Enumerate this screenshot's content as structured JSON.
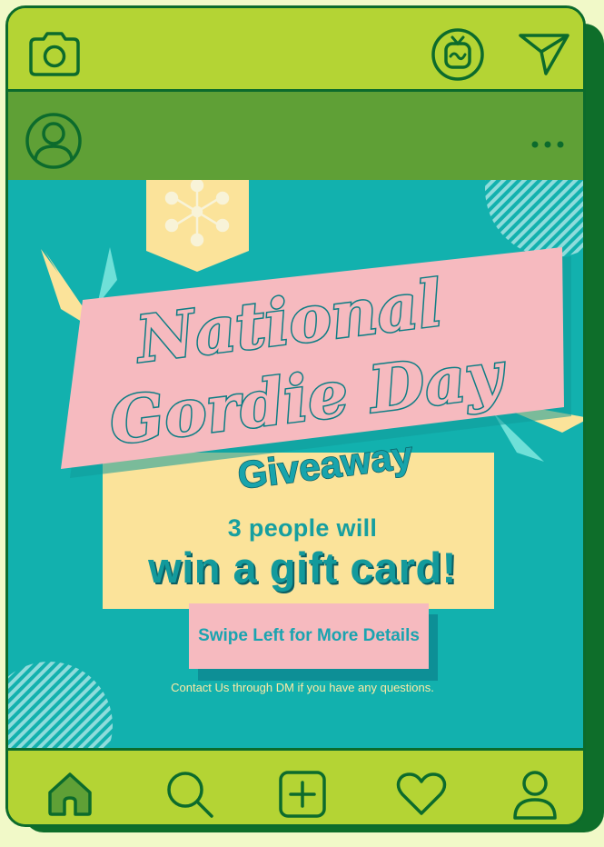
{
  "topbar": {
    "camera_icon": "camera-icon",
    "tv_icon": "igtv-icon",
    "send_icon": "send-icon"
  },
  "profile": {
    "avatar_icon": "user-circle-icon",
    "more_icon": "more-icon"
  },
  "post": {
    "title_line1": "National",
    "title_line2": "Gordie Day",
    "subtitle": "Giveaway",
    "count_text": "3 people will",
    "prize_text": "win a gift card!",
    "swipe_button": "Swipe Left for More Details",
    "contact_text": "Contact Us through DM if you have any questions."
  },
  "nav": {
    "home_icon": "home-icon",
    "search_icon": "search-icon",
    "add_icon": "add-post-icon",
    "heart_icon": "heart-icon",
    "profile_icon": "profile-icon"
  },
  "colors": {
    "frame": "#b4d434",
    "profile_bar": "#5fa036",
    "post_bg": "#12b1ae",
    "banner_pink": "#f6babf",
    "panel_yellow": "#fbe39a",
    "text_teal": "#139a9c",
    "outline": "#0c6b2c"
  }
}
